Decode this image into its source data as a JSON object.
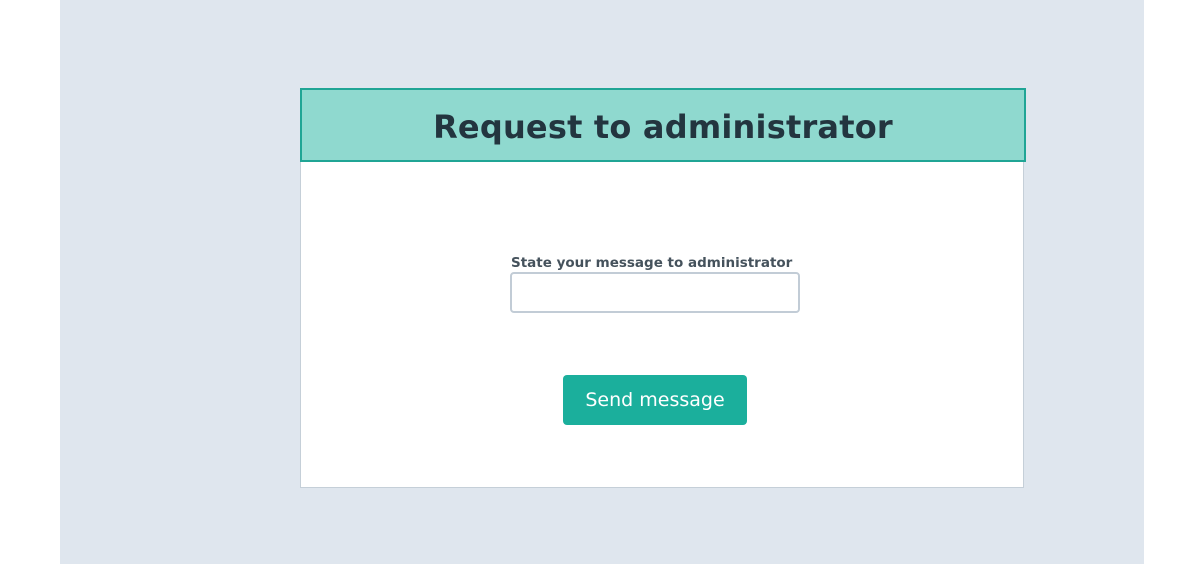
{
  "dialog": {
    "title": "Request to administrator",
    "field_label": "State your message to administrator",
    "input_value": "",
    "send_label": "Send message"
  },
  "colors": {
    "page_background": "#dfe6ee",
    "header_background": "#8fd9cf",
    "header_border": "#20a595",
    "button_background": "#1baf9c",
    "title_text": "#23353f"
  }
}
